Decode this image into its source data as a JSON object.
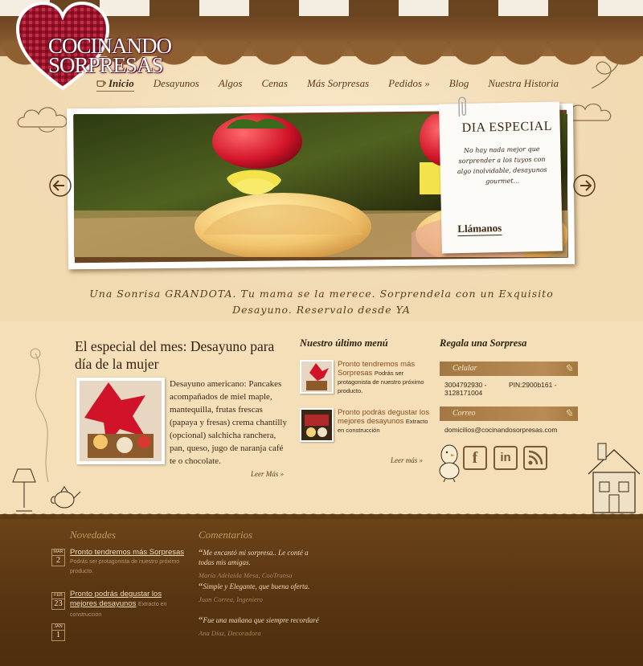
{
  "brand": {
    "line1": "Cocinando",
    "line2": "Sorpresas"
  },
  "nav": {
    "items": [
      {
        "label": "Inicio"
      },
      {
        "label": "Desayunos"
      },
      {
        "label": "Algos"
      },
      {
        "label": "Cenas"
      },
      {
        "label": "Más Sorpresas"
      },
      {
        "label": "Pedidos »"
      },
      {
        "label": "Blog"
      },
      {
        "label": "Nuestra Historia"
      }
    ]
  },
  "special_day": {
    "title": "DIA ESPECIAL",
    "text": "No hay nada mejor que sorprender a los tuyos con algo inolvidable, desayunos gourmet...",
    "cta": "Llámanos"
  },
  "tagline": "Una Sonrisa GRANDOTA. Tu mama se la merece. Sorprendela con un Exquisito Desayuno. Reservalo desde YA",
  "month_special": {
    "title": "El especial del mes: Desayuno para día de la mujer",
    "description": "Desayuno americano: Pancakes acompañados de miel maple, mantequilla, frutas frescas (papaya y fresas) crema chantilly (opcional) salchicha ranchera, pan, queso, jugo de naranja café te o chocolate.",
    "more": "Leer Más"
  },
  "latest_menu": {
    "title": "Nuestro último menú",
    "items": [
      {
        "link": "Pronto tendremos más Sorpresas",
        "text": "Podrás ser protagonista de nuestro próximo producto."
      },
      {
        "link": "Pronto podrás degustar los mejores desayunos",
        "text": "Extracto en construcción"
      }
    ],
    "more": "Leer más"
  },
  "gift": {
    "title": "Regala una Sorpresa",
    "phone_bar": "Celular",
    "phones": "3004792930 - 3128171004",
    "pin": "PIN:2900b161 -",
    "email_bar": "Correo",
    "email": "domicilios@cocinandosorpresas.com"
  },
  "social": {
    "facebook": "f",
    "linkedin": "in"
  },
  "footer": {
    "news_title": "Novedades",
    "news": [
      {
        "month": "MAR",
        "day": "2",
        "link": "Pronto tendremos más Sorpresas",
        "text": "Podrás ser protagonista de nuestro próximo producto."
      },
      {
        "month": "FEB",
        "day": "23",
        "link": "Pronto podrás degustar los mejores desayunos",
        "text": "Extracto en construcción"
      },
      {
        "month": "JAN",
        "day": "1",
        "link": "",
        "text": ""
      }
    ],
    "comments_title": "Comentarios",
    "comments": [
      {
        "text": "Me encantó mi sorpresa.. Le conté a todas mis amigas.",
        "author": "María Adelaida Mesa, CooTransa"
      },
      {
        "text": "Simple y Elegante, que buena oferta.",
        "author": "Juan Correa, Ingeniero"
      },
      {
        "text": "Fue una mañana que siempre recordaré",
        "author": "Ana Díaz, Decoradora"
      }
    ]
  },
  "colors": {
    "background": "#f4dfb9",
    "awning": "#6b4520",
    "footer": "#5a3612",
    "link": "#8a4d1c",
    "accent_red": "#a3152b"
  }
}
